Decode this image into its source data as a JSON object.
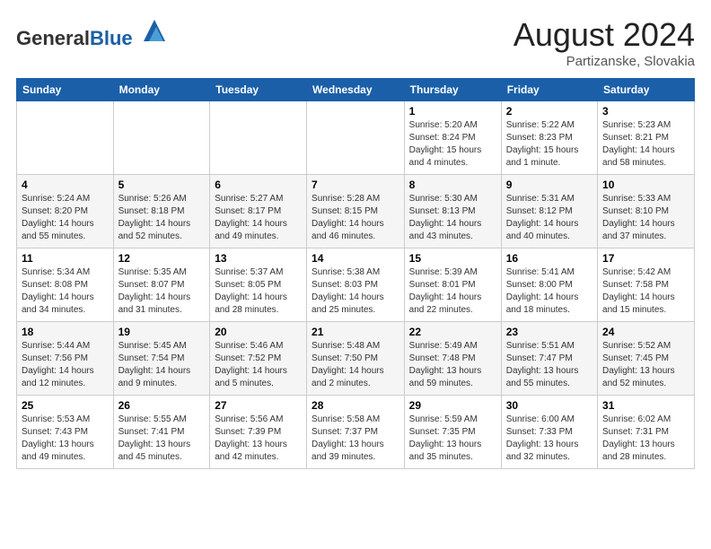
{
  "header": {
    "logo_general": "General",
    "logo_blue": "Blue",
    "month_year": "August 2024",
    "location": "Partizanske, Slovakia"
  },
  "weekdays": [
    "Sunday",
    "Monday",
    "Tuesday",
    "Wednesday",
    "Thursday",
    "Friday",
    "Saturday"
  ],
  "weeks": [
    [
      {
        "day": "",
        "info": ""
      },
      {
        "day": "",
        "info": ""
      },
      {
        "day": "",
        "info": ""
      },
      {
        "day": "",
        "info": ""
      },
      {
        "day": "1",
        "info": "Sunrise: 5:20 AM\nSunset: 8:24 PM\nDaylight: 15 hours\nand 4 minutes."
      },
      {
        "day": "2",
        "info": "Sunrise: 5:22 AM\nSunset: 8:23 PM\nDaylight: 15 hours\nand 1 minute."
      },
      {
        "day": "3",
        "info": "Sunrise: 5:23 AM\nSunset: 8:21 PM\nDaylight: 14 hours\nand 58 minutes."
      }
    ],
    [
      {
        "day": "4",
        "info": "Sunrise: 5:24 AM\nSunset: 8:20 PM\nDaylight: 14 hours\nand 55 minutes."
      },
      {
        "day": "5",
        "info": "Sunrise: 5:26 AM\nSunset: 8:18 PM\nDaylight: 14 hours\nand 52 minutes."
      },
      {
        "day": "6",
        "info": "Sunrise: 5:27 AM\nSunset: 8:17 PM\nDaylight: 14 hours\nand 49 minutes."
      },
      {
        "day": "7",
        "info": "Sunrise: 5:28 AM\nSunset: 8:15 PM\nDaylight: 14 hours\nand 46 minutes."
      },
      {
        "day": "8",
        "info": "Sunrise: 5:30 AM\nSunset: 8:13 PM\nDaylight: 14 hours\nand 43 minutes."
      },
      {
        "day": "9",
        "info": "Sunrise: 5:31 AM\nSunset: 8:12 PM\nDaylight: 14 hours\nand 40 minutes."
      },
      {
        "day": "10",
        "info": "Sunrise: 5:33 AM\nSunset: 8:10 PM\nDaylight: 14 hours\nand 37 minutes."
      }
    ],
    [
      {
        "day": "11",
        "info": "Sunrise: 5:34 AM\nSunset: 8:08 PM\nDaylight: 14 hours\nand 34 minutes."
      },
      {
        "day": "12",
        "info": "Sunrise: 5:35 AM\nSunset: 8:07 PM\nDaylight: 14 hours\nand 31 minutes."
      },
      {
        "day": "13",
        "info": "Sunrise: 5:37 AM\nSunset: 8:05 PM\nDaylight: 14 hours\nand 28 minutes."
      },
      {
        "day": "14",
        "info": "Sunrise: 5:38 AM\nSunset: 8:03 PM\nDaylight: 14 hours\nand 25 minutes."
      },
      {
        "day": "15",
        "info": "Sunrise: 5:39 AM\nSunset: 8:01 PM\nDaylight: 14 hours\nand 22 minutes."
      },
      {
        "day": "16",
        "info": "Sunrise: 5:41 AM\nSunset: 8:00 PM\nDaylight: 14 hours\nand 18 minutes."
      },
      {
        "day": "17",
        "info": "Sunrise: 5:42 AM\nSunset: 7:58 PM\nDaylight: 14 hours\nand 15 minutes."
      }
    ],
    [
      {
        "day": "18",
        "info": "Sunrise: 5:44 AM\nSunset: 7:56 PM\nDaylight: 14 hours\nand 12 minutes."
      },
      {
        "day": "19",
        "info": "Sunrise: 5:45 AM\nSunset: 7:54 PM\nDaylight: 14 hours\nand 9 minutes."
      },
      {
        "day": "20",
        "info": "Sunrise: 5:46 AM\nSunset: 7:52 PM\nDaylight: 14 hours\nand 5 minutes."
      },
      {
        "day": "21",
        "info": "Sunrise: 5:48 AM\nSunset: 7:50 PM\nDaylight: 14 hours\nand 2 minutes."
      },
      {
        "day": "22",
        "info": "Sunrise: 5:49 AM\nSunset: 7:48 PM\nDaylight: 13 hours\nand 59 minutes."
      },
      {
        "day": "23",
        "info": "Sunrise: 5:51 AM\nSunset: 7:47 PM\nDaylight: 13 hours\nand 55 minutes."
      },
      {
        "day": "24",
        "info": "Sunrise: 5:52 AM\nSunset: 7:45 PM\nDaylight: 13 hours\nand 52 minutes."
      }
    ],
    [
      {
        "day": "25",
        "info": "Sunrise: 5:53 AM\nSunset: 7:43 PM\nDaylight: 13 hours\nand 49 minutes."
      },
      {
        "day": "26",
        "info": "Sunrise: 5:55 AM\nSunset: 7:41 PM\nDaylight: 13 hours\nand 45 minutes."
      },
      {
        "day": "27",
        "info": "Sunrise: 5:56 AM\nSunset: 7:39 PM\nDaylight: 13 hours\nand 42 minutes."
      },
      {
        "day": "28",
        "info": "Sunrise: 5:58 AM\nSunset: 7:37 PM\nDaylight: 13 hours\nand 39 minutes."
      },
      {
        "day": "29",
        "info": "Sunrise: 5:59 AM\nSunset: 7:35 PM\nDaylight: 13 hours\nand 35 minutes."
      },
      {
        "day": "30",
        "info": "Sunrise: 6:00 AM\nSunset: 7:33 PM\nDaylight: 13 hours\nand 32 minutes."
      },
      {
        "day": "31",
        "info": "Sunrise: 6:02 AM\nSunset: 7:31 PM\nDaylight: 13 hours\nand 28 minutes."
      }
    ]
  ]
}
